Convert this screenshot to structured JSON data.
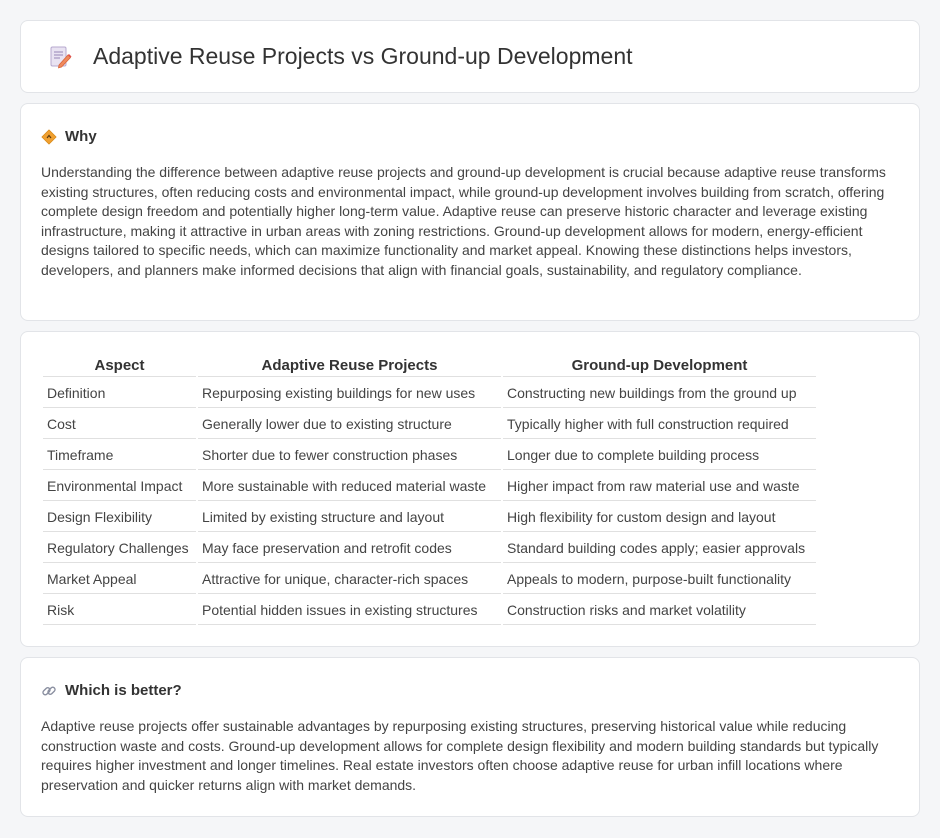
{
  "header": {
    "title": "Adaptive Reuse Projects vs Ground-up Development",
    "icon": "document-pencil-icon"
  },
  "why": {
    "title": "Why",
    "icon": "diamond-sign-icon",
    "text": "Understanding the difference between adaptive reuse projects and ground-up development is crucial because adaptive reuse transforms existing structures, often reducing costs and environmental impact, while ground-up development involves building from scratch, offering complete design freedom and potentially higher long-term value. Adaptive reuse can preserve historic character and leverage existing infrastructure, making it attractive in urban areas with zoning restrictions. Ground-up development allows for modern, energy-efficient designs tailored to specific needs, which can maximize functionality and market appeal. Knowing these distinctions helps investors, developers, and planners make informed decisions that align with financial goals, sustainability, and regulatory compliance."
  },
  "table": {
    "headers": [
      "Aspect",
      "Adaptive Reuse Projects",
      "Ground-up Development"
    ],
    "rows": [
      [
        "Definition",
        "Repurposing existing buildings for new uses",
        "Constructing new buildings from the ground up"
      ],
      [
        "Cost",
        "Generally lower due to existing structure",
        "Typically higher with full construction required"
      ],
      [
        "Timeframe",
        "Shorter due to fewer construction phases",
        "Longer due to complete building process"
      ],
      [
        "Environmental Impact",
        "More sustainable with reduced material waste",
        "Higher impact from raw material use and waste"
      ],
      [
        "Design Flexibility",
        "Limited by existing structure and layout",
        "High flexibility for custom design and layout"
      ],
      [
        "Regulatory Challenges",
        "May face preservation and retrofit codes",
        "Standard building codes apply; easier approvals"
      ],
      [
        "Market Appeal",
        "Attractive for unique, character-rich spaces",
        "Appeals to modern, purpose-built functionality"
      ],
      [
        "Risk",
        "Potential hidden issues in existing structures",
        "Construction risks and market volatility"
      ]
    ]
  },
  "better": {
    "title": "Which is better?",
    "icon": "link-icon",
    "text": "Adaptive reuse projects offer sustainable advantages by repurposing existing structures, preserving historical value while reducing construction waste and costs. Ground-up development allows for complete design flexibility and modern building standards but typically requires higher investment and longer timelines. Real estate investors often choose adaptive reuse for urban infill locations where preservation and quicker returns align with market demands."
  },
  "colors": {
    "background": "#f5f6f8",
    "card": "#ffffff",
    "border": "#e2e4e8",
    "accent_orange": "#f0a030"
  }
}
